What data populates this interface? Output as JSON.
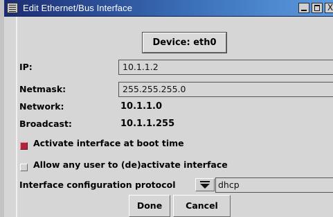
{
  "window": {
    "title": "Edit Ethernet/Bus Interface",
    "menu_icon": "window-menu-icon",
    "controls": {
      "minimize": "minimize-icon",
      "maximize": "maximize-icon",
      "close": "close-icon",
      "close_glyph": "X"
    }
  },
  "device": {
    "label": "Device: eth0"
  },
  "fields": {
    "ip": {
      "label": "IP:",
      "value": "10.1.1.2"
    },
    "netmask": {
      "label": "Netmask:",
      "value": "255.255.255.0"
    },
    "network": {
      "label": "Network:",
      "value": "10.1.1.0"
    },
    "broadcast": {
      "label": "Broadcast:",
      "value": "10.1.1.255"
    }
  },
  "options": {
    "activate_boot": {
      "label": "Activate interface at boot time",
      "checked": true
    },
    "allow_any_user": {
      "label": "Allow any user to (de)activate interface",
      "checked": false
    }
  },
  "protocol": {
    "label": "Interface configuration protocol",
    "value": "dhcp"
  },
  "buttons": {
    "done": "Done",
    "cancel": "Cancel"
  },
  "colors": {
    "checked": "#b0243d",
    "titlebar_start": "#1c2c74",
    "titlebar_end": "#5d9be0"
  }
}
